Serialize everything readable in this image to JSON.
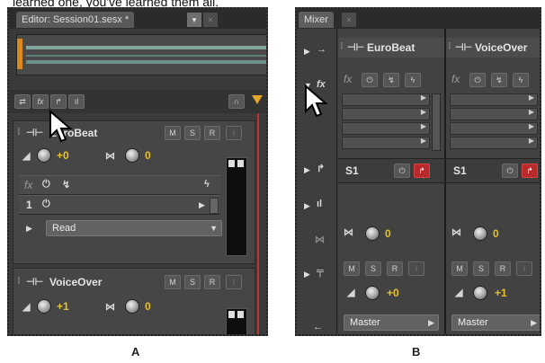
{
  "caption_text": "learned one, you've learned them all.",
  "labels": {
    "a": "A",
    "b": "B"
  },
  "editor": {
    "tab_title": "Editor: Session01.sesx *",
    "tab_menu": "▾",
    "tracks": [
      {
        "name": "EuroBeat",
        "buttons": [
          "M",
          "S",
          "R",
          "I"
        ],
        "volume": "+0",
        "pan": "0",
        "fx_row_label": "fx",
        "send_row_label": "1",
        "automation": "Read"
      },
      {
        "name": "VoiceOver",
        "buttons": [
          "M",
          "S",
          "R",
          "I"
        ],
        "volume": "+1",
        "pan": "0"
      }
    ]
  },
  "mixer": {
    "tab_title": "Mixer",
    "channels": [
      {
        "name": "EuroBeat",
        "send": "S1",
        "pan": "0",
        "buttons": [
          "M",
          "S",
          "R",
          "I"
        ],
        "volume": "+0",
        "output": "Master"
      },
      {
        "name": "VoiceOver",
        "send": "S1",
        "pan": "0",
        "buttons": [
          "M",
          "S",
          "R",
          "I"
        ],
        "volume": "+1",
        "output": "Master"
      }
    ]
  },
  "colors": {
    "panel_bg": "#3a3a3a",
    "accent_yellow": "#e8c22a",
    "accent_orange": "#d98a1c",
    "red_button": "#b8292c"
  }
}
